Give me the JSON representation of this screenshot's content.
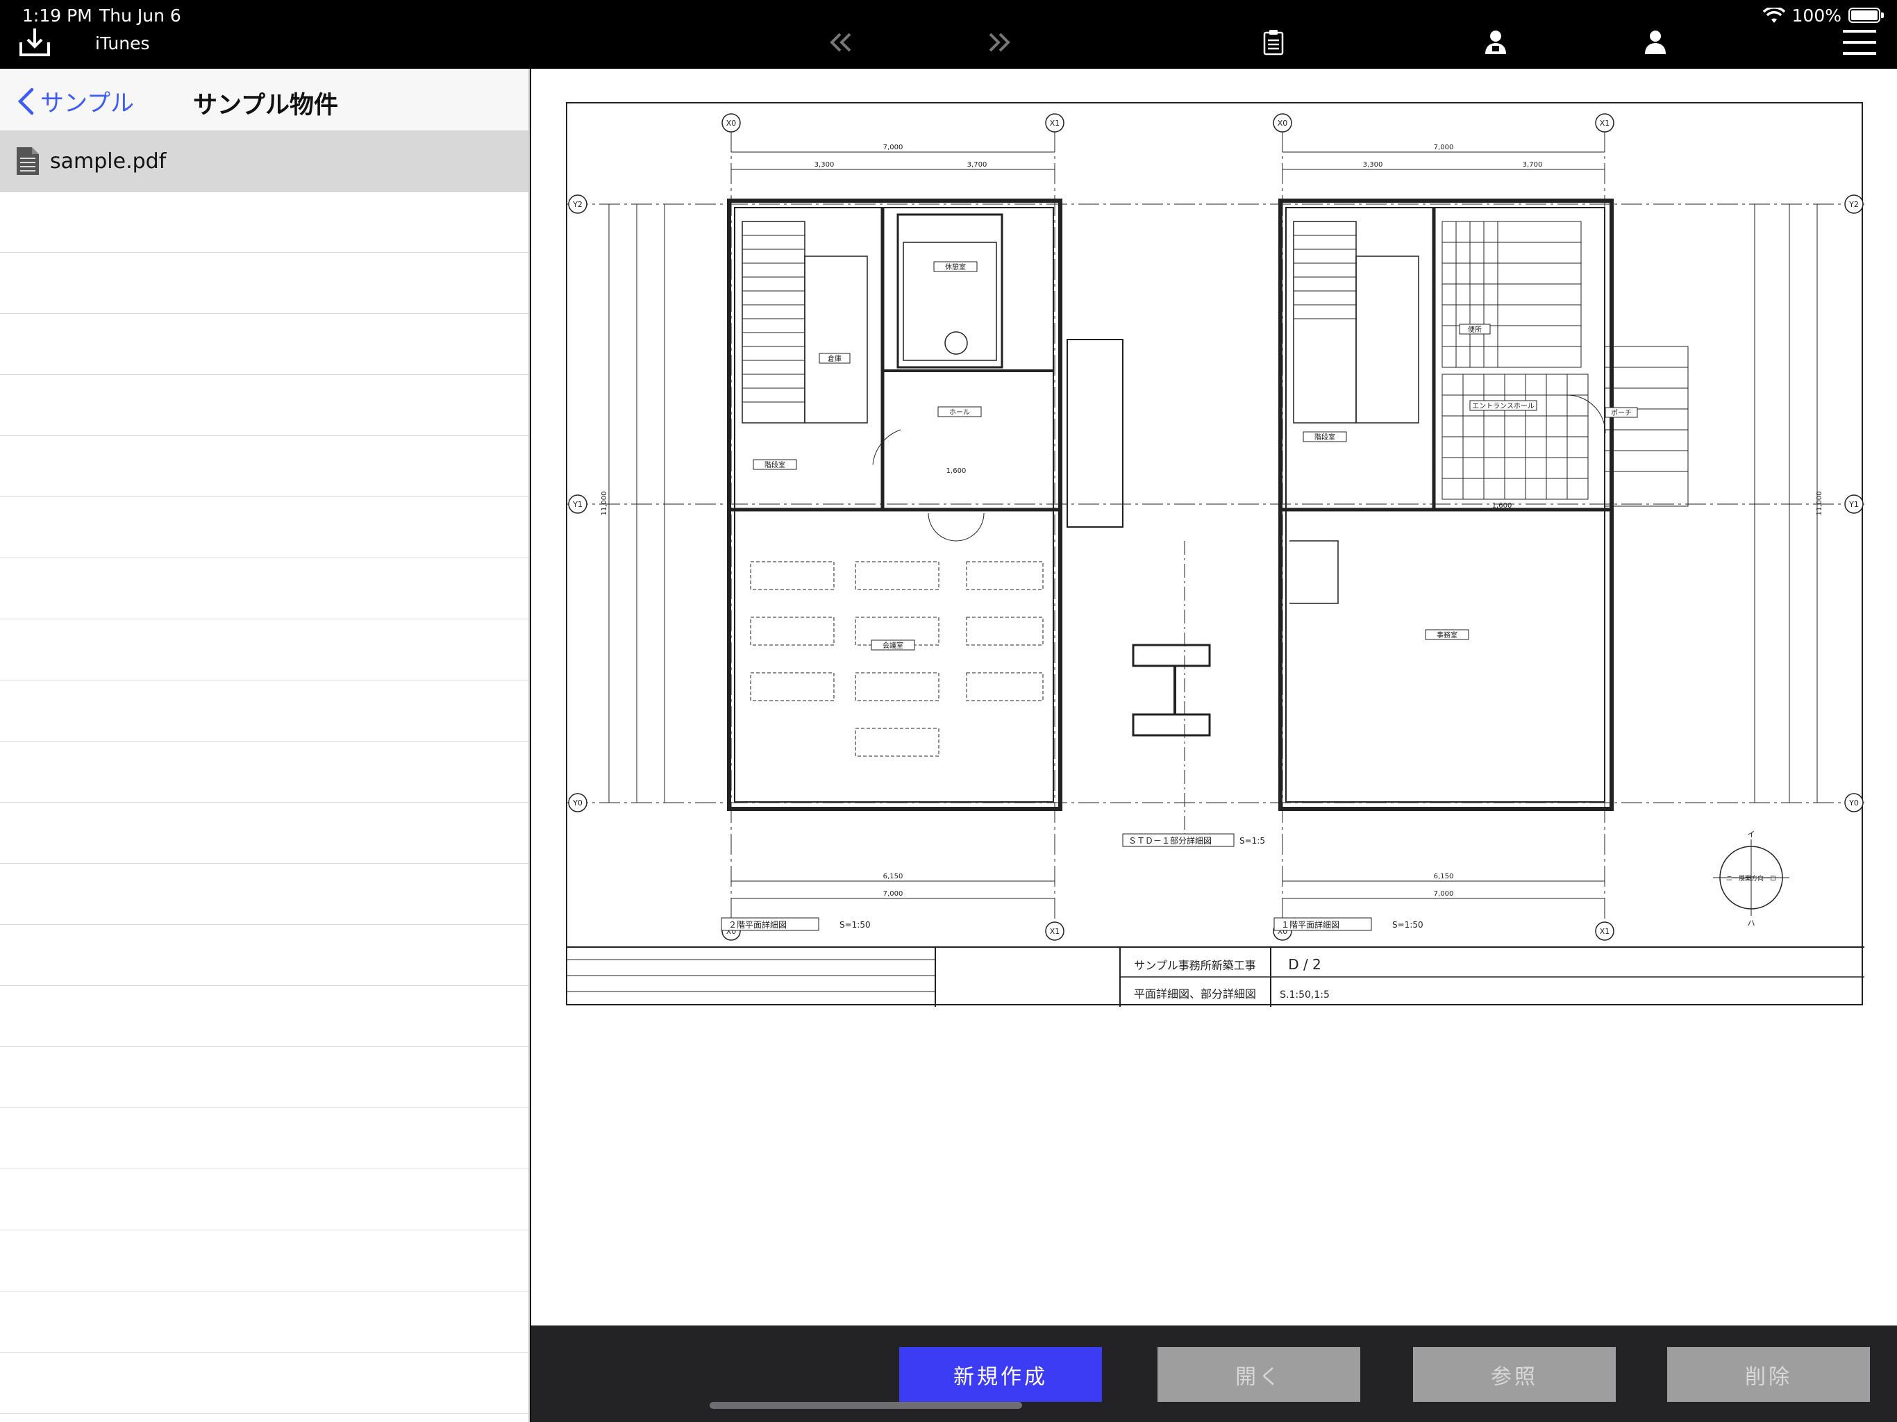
{
  "status": {
    "time": "1:19 PM",
    "date": "Thu Jun 6",
    "battery": "100%"
  },
  "toolbar": {
    "import_label": "iTunes",
    "icons": [
      "download-tray-icon",
      "double-chevron-left-icon",
      "double-chevron-right-icon",
      "clipboard-list-icon",
      "person-badge-icon",
      "person-icon",
      "hamburger-menu-icon"
    ]
  },
  "sidebar": {
    "back_label": "サンプル",
    "title": "サンプル物件",
    "files": [
      {
        "name": "sample.pdf",
        "icon": "document-icon"
      }
    ]
  },
  "drawing": {
    "title_block": {
      "project": "サンプル事務所新築工事",
      "sheet_no": "D / 2",
      "sheet_title": "平面詳細図、部分詳細図",
      "scale": "S.1:50,1:5"
    },
    "views": [
      {
        "label": "２階平面詳細図",
        "scale": "S=1:50"
      },
      {
        "label": "１階平面詳細図",
        "scale": "S=1:50"
      },
      {
        "label": "ＳＴＤ－１部分詳細図",
        "scale": "S=1:5"
      }
    ],
    "dims": {
      "overall_width": "7,000",
      "overall_height": "11,000",
      "left_upper": "3,300",
      "left_right": "3,700",
      "right_upper": "3,300",
      "right_right": "3,700",
      "bottom_inner": "6,150",
      "entry": "1,600"
    },
    "grid_marks": {
      "x0": "X0",
      "x1": "X1",
      "y0": "Y0",
      "y1": "Y1",
      "y2": "Y2"
    },
    "rooms": {
      "room_2f_a": "会議室",
      "room_2f_b": "休憩室",
      "room_2f_c": "階段室",
      "room_2f_d": "倉庫",
      "room_2f_e": "ホール",
      "room_1f_a": "事務室",
      "room_1f_b": "階段室",
      "room_1f_c": "便所",
      "room_1f_d": "エントランスホール",
      "room_1f_e": "ポーチ"
    },
    "compass": {
      "top": "イ",
      "bottom": "ハ",
      "left": "ニ",
      "right": "ロ",
      "caption": "ニ一展開方向一ロ"
    }
  },
  "actions": {
    "new": "新規作成",
    "open": "開く",
    "reference": "参照",
    "delete": "削除"
  }
}
